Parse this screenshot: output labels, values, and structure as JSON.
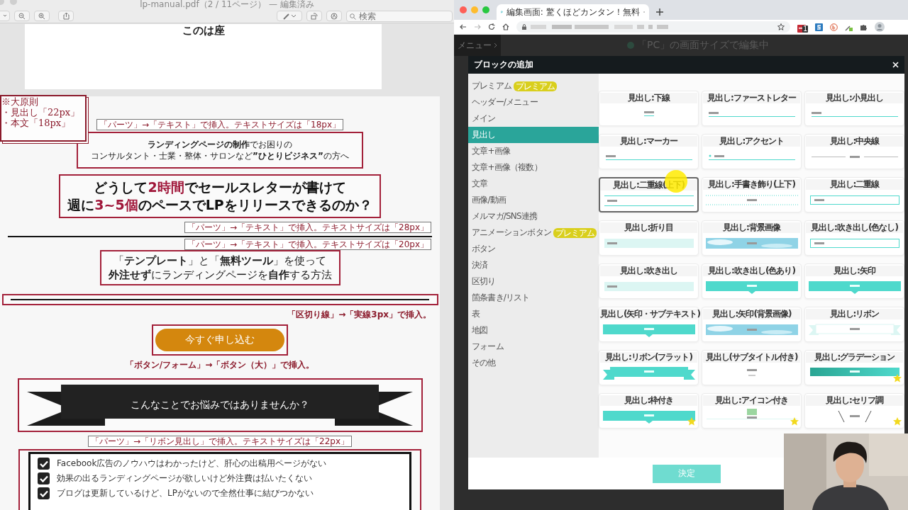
{
  "pdf_viewer": {
    "title": "lp-manual.pdf（2 / 11ページ） — 編集済み",
    "search": {
      "placeholder": "検索"
    },
    "previous_page_text": "このは座",
    "rule_note": [
      "※大原則",
      "・見出し「22px」",
      "・本文「18px」"
    ],
    "blocks": [
      {
        "kind": "annotation",
        "text": "「パーツ」→「テキスト」で挿入。テキストサイズは「18px」"
      },
      {
        "kind": "text-box",
        "lines": [
          "**ランディングページの制作**でお困りの",
          "コンサルタント・士業・整体・サロンなど**”ひとりビジネス”**の方へ"
        ]
      },
      {
        "kind": "headline",
        "lines": [
          [
            {
              "text": "どうして",
              "accent": false
            },
            {
              "text": "2時間",
              "accent": true
            },
            {
              "text": "でセールスレターが書けて",
              "accent": false
            }
          ],
          [
            {
              "text": "週に",
              "accent": false
            },
            {
              "text": "3~5個",
              "accent": true
            },
            {
              "text": "のペースでLPをリリースできるのか？",
              "accent": false
            }
          ]
        ]
      },
      {
        "kind": "side-annotation",
        "text": "「パーツ」→「テキスト」で挿入。テキストサイズは「28px」"
      },
      {
        "kind": "rule"
      },
      {
        "kind": "side-annotation",
        "text": "「パーツ」→「テキスト」で挿入。テキストサイズは「20px」"
      },
      {
        "kind": "lead-box",
        "lines": [
          "「**テンプレート**」と「**無料ツール**」を使って",
          "**外注せず**にランディングページを**自作**する方法"
        ]
      },
      {
        "kind": "divider-box"
      },
      {
        "kind": "side-note",
        "text": "「区切り線」→「実線3px」で挿入。"
      },
      {
        "kind": "button-box",
        "label": "今すぐ申し込む"
      },
      {
        "kind": "note",
        "text": "「ボタン/フォーム」→「ボタン（大）」で挿入。"
      },
      {
        "kind": "ribbon-box",
        "text": "こんなことでお悩みではありませんか？"
      },
      {
        "kind": "annotation",
        "text": "「パーツ」→「リボン見出し」で挿入。テキストサイズは「22px」"
      },
      {
        "kind": "checklist",
        "items": [
          {
            "text": "Facebook広告のノウハウはわかったけど、肝心の出稿用ページがない",
            "checked": true
          },
          {
            "text": "効果の出るランディングページが欲しいけど外注費は払いたくない",
            "checked": true
          },
          {
            "text": "ブログは更新しているけど、LPがないので全然仕事に結びつかない",
            "checked": true
          }
        ]
      }
    ]
  },
  "browser": {
    "tab_title": "編集画面: 驚くほどカンタン！無料",
    "extension_badge": "1"
  },
  "editor": {
    "menu_button": "メニュー",
    "status": "「PC」の画面サイズで編集中",
    "dialog": {
      "title": "ブロックの追加",
      "categories": [
        {
          "label": "プレミアム",
          "badge": "プレミアム",
          "selected": false
        },
        {
          "label": "ヘッダー/メニュー",
          "selected": false
        },
        {
          "label": "メイン",
          "selected": false
        },
        {
          "label": "見出し",
          "selected": true
        },
        {
          "label": "文章+画像",
          "selected": false
        },
        {
          "label": "文章+画像（複数）",
          "selected": false
        },
        {
          "label": "文章",
          "selected": false
        },
        {
          "label": "画像/動画",
          "selected": false
        },
        {
          "label": "メルマガ/SNS連携",
          "selected": false
        },
        {
          "label": "アニメーションボタン",
          "badge": "プレミアム",
          "selected": false
        },
        {
          "label": "ボタン",
          "selected": false
        },
        {
          "label": "決済",
          "selected": false
        },
        {
          "label": "区切り",
          "selected": false
        },
        {
          "label": "箇条書き/リスト",
          "selected": false
        },
        {
          "label": "表",
          "selected": false
        },
        {
          "label": "地図",
          "selected": false
        },
        {
          "label": "フォーム",
          "selected": false
        },
        {
          "label": "その他",
          "selected": false
        }
      ],
      "blocks": [
        {
          "title": "見出し:下線",
          "selected": false,
          "premium": false
        },
        {
          "title": "見出し:ファーストレター",
          "selected": false,
          "premium": false
        },
        {
          "title": "見出し:小見出し",
          "selected": false,
          "premium": false
        },
        {
          "title": "見出し:マーカー",
          "selected": false,
          "premium": false
        },
        {
          "title": "見出し:アクセント",
          "selected": false,
          "premium": false
        },
        {
          "title": "見出し:中央線",
          "selected": false,
          "premium": false
        },
        {
          "title": "見出し:二重線(上下)",
          "selected": true,
          "premium": false
        },
        {
          "title": "見出し:手書き飾り(上下)",
          "selected": false,
          "premium": false
        },
        {
          "title": "見出し:二重線",
          "selected": false,
          "premium": false
        },
        {
          "title": "見出し:折り目",
          "selected": false,
          "premium": false
        },
        {
          "title": "見出し:背景画像",
          "selected": false,
          "premium": false
        },
        {
          "title": "見出し:吹き出し(色なし)",
          "selected": false,
          "premium": false
        },
        {
          "title": "見出し:吹き出し",
          "selected": false,
          "premium": false
        },
        {
          "title": "見出し:吹き出し(色あり)",
          "selected": false,
          "premium": false
        },
        {
          "title": "見出し:矢印",
          "selected": false,
          "premium": false
        },
        {
          "title": "見出し(矢印・サブテキスト)",
          "selected": false,
          "premium": false
        },
        {
          "title": "見出し:矢印(背景画像)",
          "selected": false,
          "premium": false
        },
        {
          "title": "見出し:リボン",
          "selected": false,
          "premium": false
        },
        {
          "title": "見出し:リボン(フラット)",
          "selected": false,
          "premium": false
        },
        {
          "title": "見出し(サブタイトル付き)",
          "selected": false,
          "premium": false
        },
        {
          "title": "見出し:グラデーション",
          "selected": false,
          "premium": true
        },
        {
          "title": "見出し:枠付き",
          "selected": false,
          "premium": true
        },
        {
          "title": "見出し:アイコン付き",
          "selected": false,
          "premium": true
        },
        {
          "title": "見出し:セリフ調",
          "selected": false,
          "premium": true
        }
      ],
      "confirm_button": "決定"
    }
  }
}
